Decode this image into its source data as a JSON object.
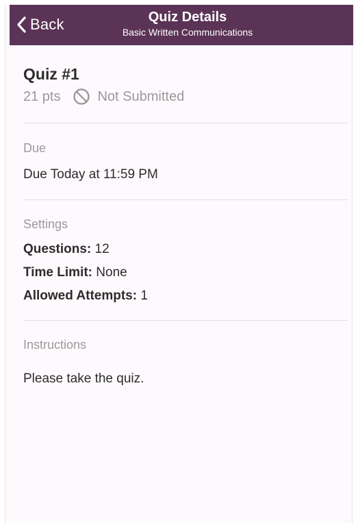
{
  "navbar": {
    "back_label": "Back",
    "title": "Quiz Details",
    "subtitle": "Basic Written Communications"
  },
  "quiz": {
    "title": "Quiz #1",
    "points": "21 pts",
    "status": "Not Submitted",
    "status_icon": "no-entry-icon"
  },
  "due": {
    "label": "Due",
    "value": "Due Today at 11:59 PM"
  },
  "settings": {
    "label": "Settings",
    "items": [
      {
        "name": "Questions:",
        "value": "12"
      },
      {
        "name": "Time Limit:",
        "value": "None"
      },
      {
        "name": "Allowed Attempts:",
        "value": "1"
      }
    ]
  },
  "instructions": {
    "label": "Instructions",
    "text": "Please take the quiz."
  },
  "colors": {
    "navbar": "#5b3356",
    "background": "#fdf9fd",
    "muted_text": "#9a9a9a",
    "text": "#2c2c2c"
  }
}
